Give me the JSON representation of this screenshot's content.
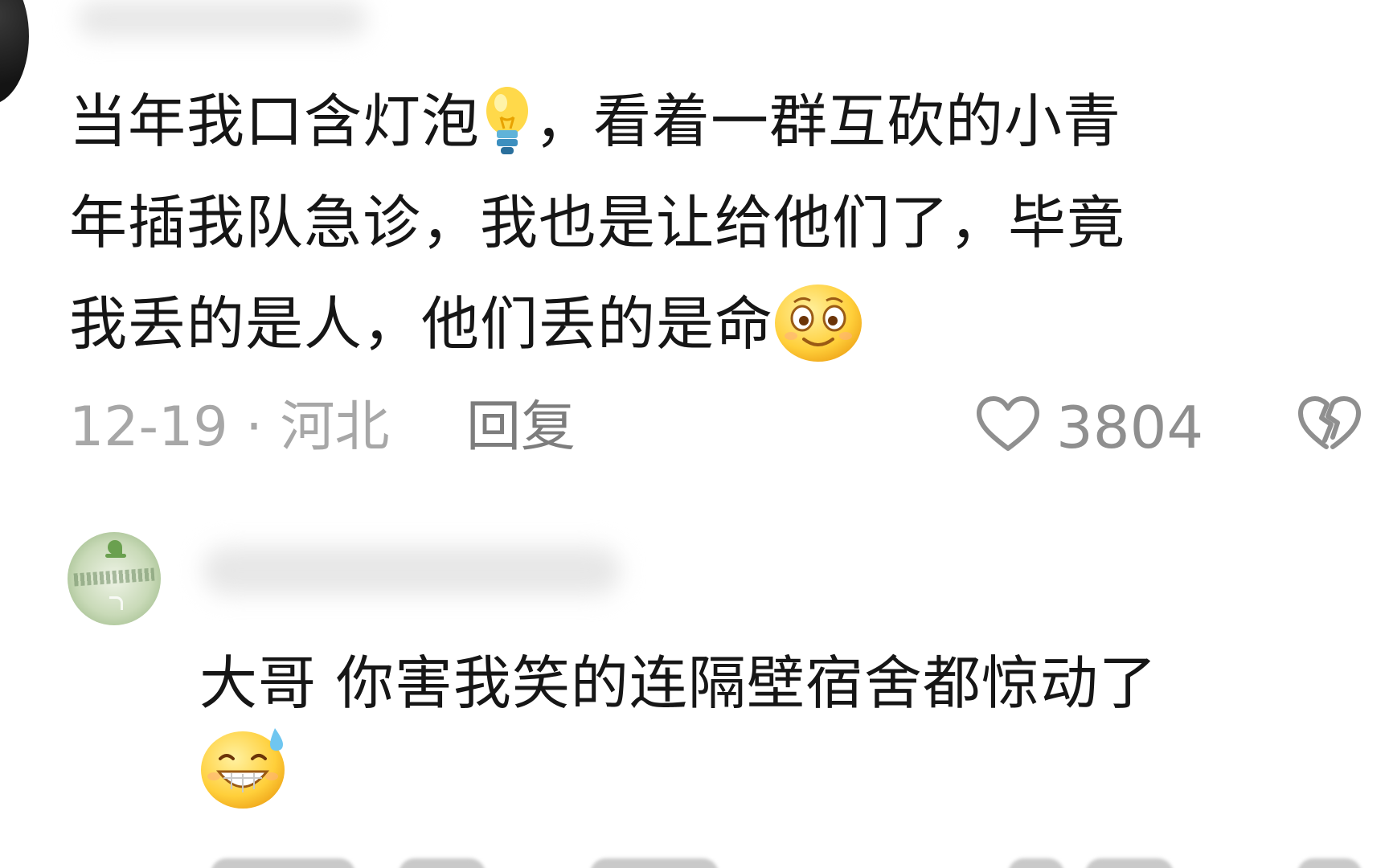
{
  "comment": {
    "text_line_1_a": "当年我口含灯泡",
    "text_line_1_b": "，看着一群互砍的小青",
    "text_line_2": "年插我队急诊，我也是让给他们了，毕竟",
    "text_line_3": "我丢的是人，他们丢的是命",
    "emoji_1": "lightbulb-emoji",
    "emoji_2": "smiling-face-emoji",
    "date_location": "12-19 · 河北",
    "reply_label": "回复",
    "like_count": "3804",
    "like_icon": "heart-outline-icon",
    "dislike_icon": "broken-heart-icon"
  },
  "reply": {
    "text": "大哥 你害我笑的连隔壁宿舍都惊动了",
    "emoji": "grinning-sweat-emoji"
  },
  "colors": {
    "text": "#161616",
    "meta": "#a7a7a7",
    "reply_action": "#7d7d7d",
    "icons": "#8f8f8f"
  }
}
